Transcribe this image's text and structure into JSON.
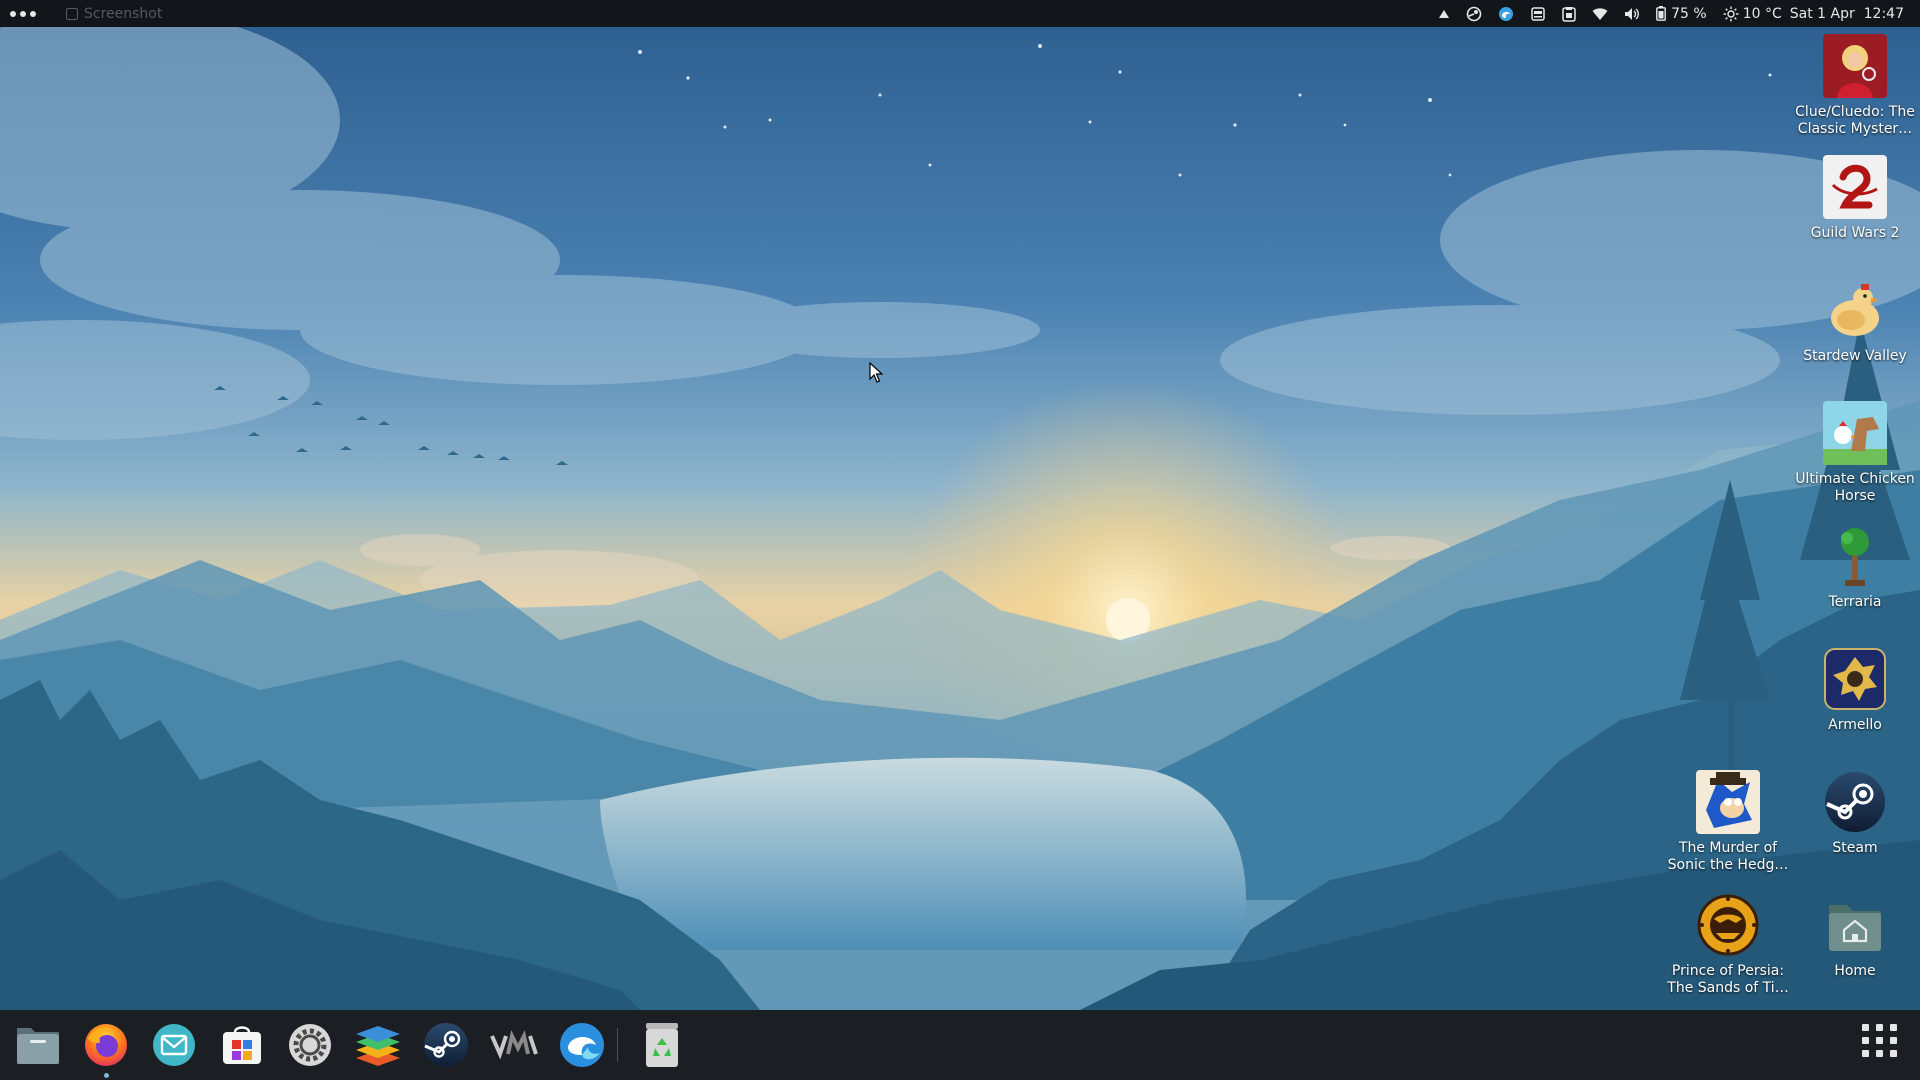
{
  "topbar": {
    "window_title": "Screenshot",
    "battery": "75 %",
    "weather": "10 °C",
    "datetime": "Sat 1 Apr  12:47",
    "tray_icons": [
      "notification-icon",
      "steam-tray-icon",
      "edge-tray-icon",
      "screencast-icon",
      "clipboard-icon",
      "wifi-icon",
      "volume-icon",
      "battery-icon",
      "weather-sun-icon"
    ]
  },
  "desktop": {
    "icons": [
      {
        "name": "clue-cluedo",
        "label": "Clue/Cluedo: The Classic Myster…"
      },
      {
        "name": "guild-wars-2",
        "label": "Guild Wars 2"
      },
      {
        "name": "stardew-valley",
        "label": "Stardew Valley"
      },
      {
        "name": "ultimate-chicken-horse",
        "label": "Ultimate Chicken Horse"
      },
      {
        "name": "terraria",
        "label": "Terraria"
      },
      {
        "name": "armello",
        "label": "Armello"
      },
      {
        "name": "murder-of-sonic",
        "label": "The Murder of Sonic the Hedg…"
      },
      {
        "name": "steam",
        "label": "Steam"
      },
      {
        "name": "prince-of-persia",
        "label": "Prince of Persia: The Sands of Ti…"
      },
      {
        "name": "home",
        "label": "Home"
      }
    ]
  },
  "dock": {
    "items": [
      "files-icon",
      "firefox-icon",
      "mail-icon",
      "software-store-icon",
      "settings-icon",
      "layers-app-icon",
      "steam-icon",
      "vm-icon",
      "edge-icon",
      "trash-icon"
    ]
  },
  "colors": {
    "topbar": "#121519",
    "dock": "#1b1e22",
    "sky_top": "#2e6393",
    "horizon_glow": "#f2d9a0"
  }
}
